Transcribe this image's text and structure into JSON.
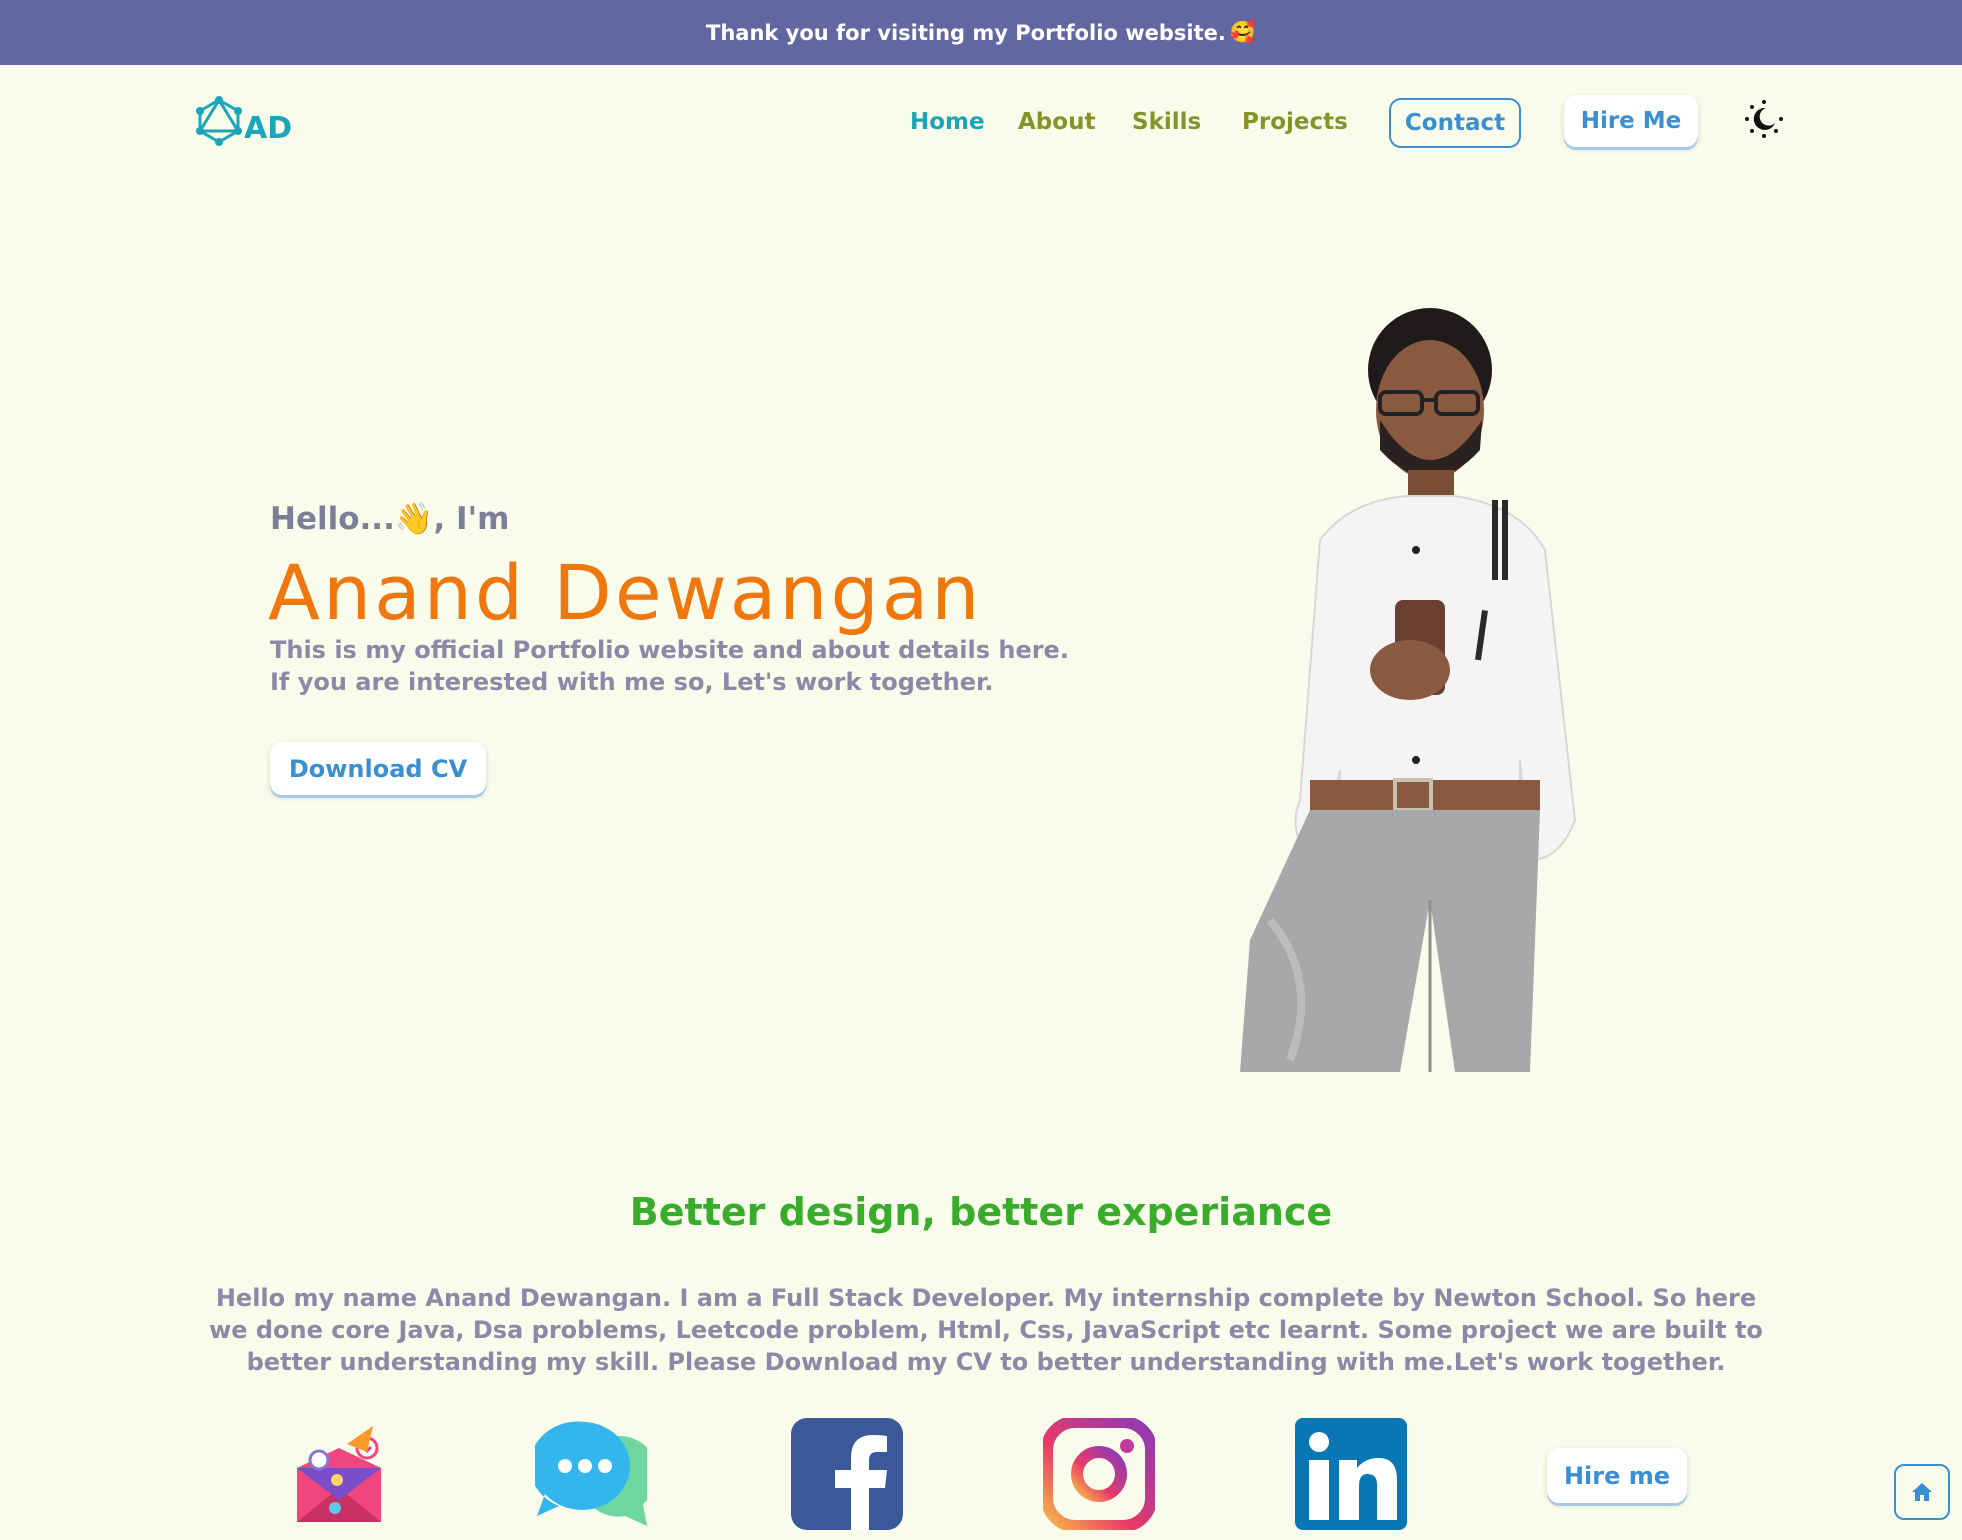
{
  "banner": {
    "text": "Thank you for visiting my Portfolio website.",
    "emoji": "🥰"
  },
  "logo": {
    "text": "AD"
  },
  "nav": {
    "items": [
      {
        "label": "Home",
        "active": true
      },
      {
        "label": "About"
      },
      {
        "label": "Skills"
      },
      {
        "label": "Projects"
      }
    ],
    "contact_label": "Contact",
    "hire_label": "Hire Me",
    "theme_icon": "moon-sun-icon"
  },
  "hero": {
    "greeting_pre": "Hello...",
    "greeting_wave": "👋",
    "greeting_post": ", I'm",
    "name": "Anand Dewangan",
    "intro": "This is my official Portfolio website and about details here. If you are interested with me so, Let's work together.",
    "cv_label": "Download CV"
  },
  "about": {
    "tagline": "Better design, better experiance",
    "text": "Hello my name Anand Dewangan. I am a Full Stack Developer. My internship complete by Newton School. So here we done core Java, Dsa problems, Leetcode problem, Html, Css, JavaScript etc learnt. Some project we are built to better understanding my skill. Please Download my CV to better understanding with me.Let's work together."
  },
  "social": {
    "icons": [
      "mail-icon",
      "chat-icon",
      "facebook-icon",
      "instagram-icon",
      "linkedin-icon"
    ],
    "hire_label": "Hire me"
  },
  "colors": {
    "background": "#f9fcea",
    "banner": "#6167a0",
    "accent_teal": "#1aa6b8",
    "nav_olive": "#86922a",
    "name_orange": "#f0770e",
    "button_blue": "#3a8fd0",
    "tagline_green": "#3aac2c"
  }
}
